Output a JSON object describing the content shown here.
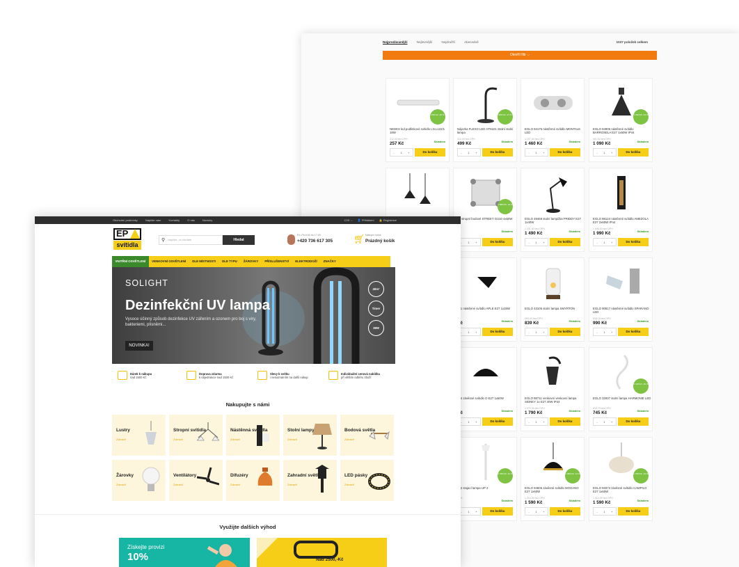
{
  "back": {
    "sort_tabs": [
      "Nejprodávanější",
      "Nejlevnější",
      "Nejdražší",
      "Abecedně"
    ],
    "total_count": "1037 položek celkem",
    "filter_button": "Otevřít filtr ⌵",
    "qty_value": "1",
    "cart_label": "Do košíku",
    "stock_label": "Skladem",
    "products": [
      {
        "name": "NEDES led podlinkové svítidlo LN.L122/1 18W",
        "note": "212,40 bez DPH",
        "price": "257 Kč",
        "badge": "4/50 ks/ -29 %"
      },
      {
        "name": "Nájezka FLEXO LED HT6101 Stolní stolní lampa",
        "note": "412,40 bez DPH",
        "price": "499 Kč",
        "badge": "4/50 ks/ -27 %"
      },
      {
        "name": "EGLO 94176 nástěnné svítidlo MONTALE LED",
        "note": "1 207,44 bez DPH",
        "price": "1 460 Kč",
        "badge": ""
      },
      {
        "name": "EGLO 94905 nástěnné svítidlo BARROSELA E27 1x60W IP44",
        "note": "901,62 bez DPH",
        "price": "1 090 Kč",
        "badge": "1 248 Kč/ -13 %"
      },
      {
        "name": "",
        "note": "",
        "price": "",
        "badge": ""
      },
      {
        "name": "58 stropní bodové STREET GU10 4x50W",
        "note": "",
        "price": "",
        "badge": "1 688 Kč/ -44 %"
      },
      {
        "name": "EGLO 49469 stolní lampička PRIDDY E27 1x40W",
        "note": "1 231,40 bez DPH",
        "price": "1 490 Kč",
        "badge": ""
      },
      {
        "name": "EGLO 98124 nástěnné svítidlo AMEZOLA E27 2x60W IP44",
        "note": "1 645,03 bez DPH",
        "price": "1 990 Kč",
        "badge": ""
      },
      {
        "name": "121 nástěnné svítidlo APLE E27 1x28W",
        "note": "",
        "price": "Kč",
        "badge": ""
      },
      {
        "name": "EGLO 43105 stolní lampa SMYRTON",
        "note": "693,40 bez DPH",
        "price": "839 Kč",
        "badge": ""
      },
      {
        "name": "EGLO 90817 nástěnné svítidlo SPARANO LED",
        "note": "818,18 bez DPH",
        "price": "990 Kč",
        "badge": ""
      },
      {
        "name": "594 závěsné svítidlo O E27 1x60W",
        "note": "",
        "price": "Kč",
        "badge": ""
      },
      {
        "name": "EGLO 88711 venkovní venkovní lampa SIDNEY 1x E27 40W IP44",
        "note": "1 479,34 bez DPH",
        "price": "1 790 Kč",
        "badge": ""
      },
      {
        "name": "EGLO 32937 stolní lampa HARMONIE LED",
        "note": "615,70 bez DPH",
        "price": "745 Kč",
        "badge": "1 118 Kč/ -33 %"
      },
      {
        "name": "342 stojací lampa UP 2",
        "note": "DPH",
        "price": "",
        "badge": "1 768 Kč/ -10 %"
      },
      {
        "name": "EGLO 94605 závěsné svítidlo MOGANO E27 1x60W",
        "note": "1 314,05 bez DPH",
        "price": "1 590 Kč",
        "badge": "1 368 Kč/ -14 %"
      },
      {
        "name": "EGLO 93374 závěsné svítidlo CAMPILO E27 1x60W",
        "note": "1 314,05 bez DPH",
        "price": "1 590 Kč",
        "badge": "1 768 Kč/ -16 %"
      }
    ]
  },
  "front": {
    "top_links": [
      "Obchodní podmínky",
      "Napište nám",
      "Kontakty",
      "O nás",
      "Novinky"
    ],
    "top_right": [
      "CZK ⌵",
      "👤 Přihlášení",
      "🔒 Registrace"
    ],
    "logo_top": "EP",
    "logo_bottom": "svítidla",
    "search_placeholder": "Napište, co hledáte",
    "search_button": "Hledat",
    "phone_hours": "Po–Pá 8:00 do 17:00",
    "phone_number": "+420 736 617 305",
    "cart_heading": "Nákupní košík",
    "cart_status": "Prázdný košík",
    "nav": [
      "VNITŘNÍ OSVĚTLENÍ",
      "VENKOVNÍ OSVĚTLENÍ",
      "DLE MÍSTNOSTI",
      "DLE TYPU",
      "ŽÁROVKY",
      "PŘÍSLUŠENSTVÍ",
      "ELEKTRODOŽÍ",
      "ZNAČKY"
    ],
    "banner": {
      "brand": "SOLIGHT",
      "title": "Dezinfekční UV lampa",
      "subtitle": "Vysoce účinný způsob dezinfekce UV zářením a ozonem pro boj s viry, bakteriemi, plísněmi...",
      "button": "NOVINKA!",
      "badges": [
        "40m²",
        "Timer",
        "38W"
      ]
    },
    "features": [
      {
        "title": "Dárek k nákupu",
        "text": "nad 1500 Kč"
      },
      {
        "title": "Doprava zdarma",
        "text": "k objednávce nad 1500 Kč"
      },
      {
        "title": "Slevy k svítku",
        "text": "i nenaznámím na další nákup"
      },
      {
        "title": "Individuální cenová nabídka",
        "text": "při větším odběru zboží"
      }
    ],
    "shop_heading": "Nakupujte s námi",
    "category_link": "Zobrazit",
    "categories": [
      "Lustry",
      "Stropní svítidla",
      "Nástěnná svítidla",
      "Stolní lampy",
      "Bodová světla",
      "Žárovky",
      "Ventilátory",
      "Difuzéry",
      "Zahradní světla",
      "LED pásky"
    ],
    "advantages_heading": "Využijte dalších výhod",
    "promo1_line1": "Získejte provizi",
    "promo1_line2": "10%",
    "promo2_text": "Nad 2500,-Kč"
  },
  "colors": {
    "accent": "#f6ce18",
    "green": "#3a8a2c",
    "orange": "#f27b0f",
    "badge": "#7fc343"
  }
}
